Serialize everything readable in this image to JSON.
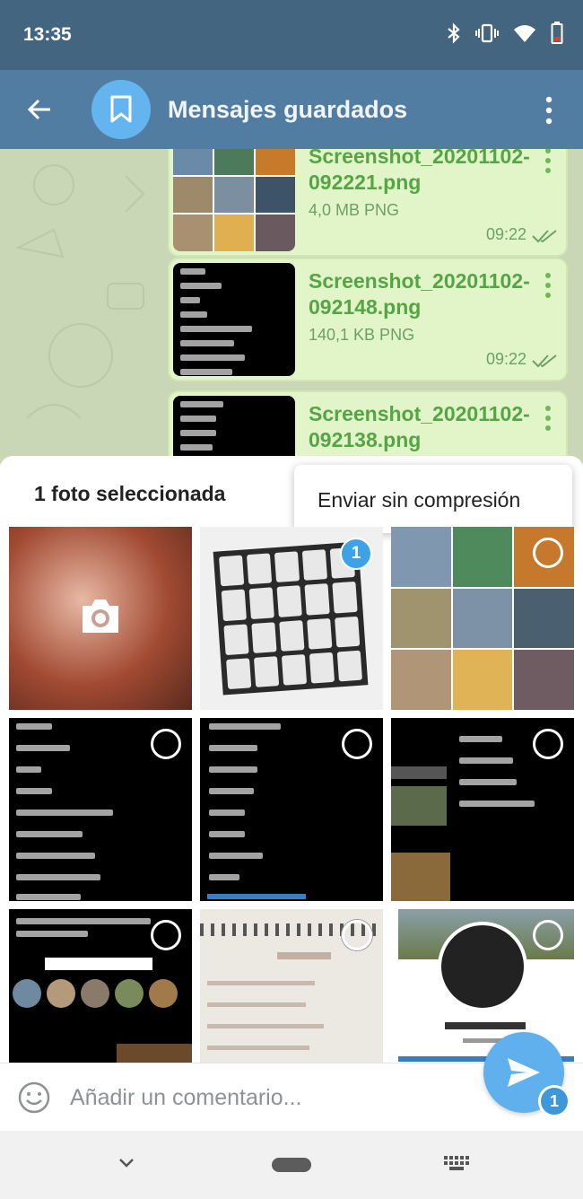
{
  "status_bar": {
    "time": "13:35",
    "icons": [
      "bluetooth-icon",
      "vibrate-icon",
      "wifi-icon",
      "battery-icon"
    ]
  },
  "toolbar": {
    "title": "Mensajes guardados",
    "avatar_icon": "bookmark-icon"
  },
  "messages": [
    {
      "file_name": "Screenshot_20201102-092221.png",
      "meta": "4,0 MB PNG",
      "time": "09:22"
    },
    {
      "file_name": "Screenshot_20201102-092148.png",
      "meta": "140,1 KB PNG",
      "time": "09:22"
    },
    {
      "file_name": "Screenshot_20201102-092138.png",
      "meta": "",
      "time": ""
    }
  ],
  "sheet": {
    "selection_title": "1 foto seleccionada",
    "popup_option": "Enviar sin compresión",
    "selected_badge": "1",
    "comment_placeholder": "Añadir un comentario...",
    "send_count": "1"
  },
  "colors": {
    "status_bar": "#446580",
    "toolbar": "#527da3",
    "accent": "#5fb0ec",
    "message_bubble": "#e2f5c9",
    "file_name": "#55a546"
  }
}
